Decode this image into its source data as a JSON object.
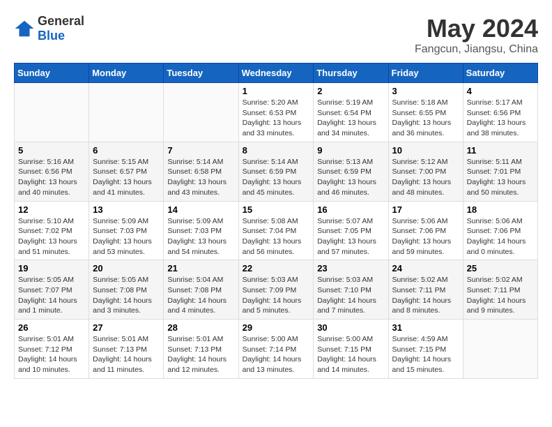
{
  "header": {
    "logo_general": "General",
    "logo_blue": "Blue",
    "month_title": "May 2024",
    "location": "Fangcun, Jiangsu, China"
  },
  "weekdays": [
    "Sunday",
    "Monday",
    "Tuesday",
    "Wednesday",
    "Thursday",
    "Friday",
    "Saturday"
  ],
  "weeks": [
    [
      {
        "day": "",
        "sunrise": "",
        "sunset": "",
        "daylight": ""
      },
      {
        "day": "",
        "sunrise": "",
        "sunset": "",
        "daylight": ""
      },
      {
        "day": "",
        "sunrise": "",
        "sunset": "",
        "daylight": ""
      },
      {
        "day": "1",
        "sunrise": "Sunrise: 5:20 AM",
        "sunset": "Sunset: 6:53 PM",
        "daylight": "Daylight: 13 hours and 33 minutes."
      },
      {
        "day": "2",
        "sunrise": "Sunrise: 5:19 AM",
        "sunset": "Sunset: 6:54 PM",
        "daylight": "Daylight: 13 hours and 34 minutes."
      },
      {
        "day": "3",
        "sunrise": "Sunrise: 5:18 AM",
        "sunset": "Sunset: 6:55 PM",
        "daylight": "Daylight: 13 hours and 36 minutes."
      },
      {
        "day": "4",
        "sunrise": "Sunrise: 5:17 AM",
        "sunset": "Sunset: 6:56 PM",
        "daylight": "Daylight: 13 hours and 38 minutes."
      }
    ],
    [
      {
        "day": "5",
        "sunrise": "Sunrise: 5:16 AM",
        "sunset": "Sunset: 6:56 PM",
        "daylight": "Daylight: 13 hours and 40 minutes."
      },
      {
        "day": "6",
        "sunrise": "Sunrise: 5:15 AM",
        "sunset": "Sunset: 6:57 PM",
        "daylight": "Daylight: 13 hours and 41 minutes."
      },
      {
        "day": "7",
        "sunrise": "Sunrise: 5:14 AM",
        "sunset": "Sunset: 6:58 PM",
        "daylight": "Daylight: 13 hours and 43 minutes."
      },
      {
        "day": "8",
        "sunrise": "Sunrise: 5:14 AM",
        "sunset": "Sunset: 6:59 PM",
        "daylight": "Daylight: 13 hours and 45 minutes."
      },
      {
        "day": "9",
        "sunrise": "Sunrise: 5:13 AM",
        "sunset": "Sunset: 6:59 PM",
        "daylight": "Daylight: 13 hours and 46 minutes."
      },
      {
        "day": "10",
        "sunrise": "Sunrise: 5:12 AM",
        "sunset": "Sunset: 7:00 PM",
        "daylight": "Daylight: 13 hours and 48 minutes."
      },
      {
        "day": "11",
        "sunrise": "Sunrise: 5:11 AM",
        "sunset": "Sunset: 7:01 PM",
        "daylight": "Daylight: 13 hours and 50 minutes."
      }
    ],
    [
      {
        "day": "12",
        "sunrise": "Sunrise: 5:10 AM",
        "sunset": "Sunset: 7:02 PM",
        "daylight": "Daylight: 13 hours and 51 minutes."
      },
      {
        "day": "13",
        "sunrise": "Sunrise: 5:09 AM",
        "sunset": "Sunset: 7:03 PM",
        "daylight": "Daylight: 13 hours and 53 minutes."
      },
      {
        "day": "14",
        "sunrise": "Sunrise: 5:09 AM",
        "sunset": "Sunset: 7:03 PM",
        "daylight": "Daylight: 13 hours and 54 minutes."
      },
      {
        "day": "15",
        "sunrise": "Sunrise: 5:08 AM",
        "sunset": "Sunset: 7:04 PM",
        "daylight": "Daylight: 13 hours and 56 minutes."
      },
      {
        "day": "16",
        "sunrise": "Sunrise: 5:07 AM",
        "sunset": "Sunset: 7:05 PM",
        "daylight": "Daylight: 13 hours and 57 minutes."
      },
      {
        "day": "17",
        "sunrise": "Sunrise: 5:06 AM",
        "sunset": "Sunset: 7:06 PM",
        "daylight": "Daylight: 13 hours and 59 minutes."
      },
      {
        "day": "18",
        "sunrise": "Sunrise: 5:06 AM",
        "sunset": "Sunset: 7:06 PM",
        "daylight": "Daylight: 14 hours and 0 minutes."
      }
    ],
    [
      {
        "day": "19",
        "sunrise": "Sunrise: 5:05 AM",
        "sunset": "Sunset: 7:07 PM",
        "daylight": "Daylight: 14 hours and 1 minute."
      },
      {
        "day": "20",
        "sunrise": "Sunrise: 5:05 AM",
        "sunset": "Sunset: 7:08 PM",
        "daylight": "Daylight: 14 hours and 3 minutes."
      },
      {
        "day": "21",
        "sunrise": "Sunrise: 5:04 AM",
        "sunset": "Sunset: 7:08 PM",
        "daylight": "Daylight: 14 hours and 4 minutes."
      },
      {
        "day": "22",
        "sunrise": "Sunrise: 5:03 AM",
        "sunset": "Sunset: 7:09 PM",
        "daylight": "Daylight: 14 hours and 5 minutes."
      },
      {
        "day": "23",
        "sunrise": "Sunrise: 5:03 AM",
        "sunset": "Sunset: 7:10 PM",
        "daylight": "Daylight: 14 hours and 7 minutes."
      },
      {
        "day": "24",
        "sunrise": "Sunrise: 5:02 AM",
        "sunset": "Sunset: 7:11 PM",
        "daylight": "Daylight: 14 hours and 8 minutes."
      },
      {
        "day": "25",
        "sunrise": "Sunrise: 5:02 AM",
        "sunset": "Sunset: 7:11 PM",
        "daylight": "Daylight: 14 hours and 9 minutes."
      }
    ],
    [
      {
        "day": "26",
        "sunrise": "Sunrise: 5:01 AM",
        "sunset": "Sunset: 7:12 PM",
        "daylight": "Daylight: 14 hours and 10 minutes."
      },
      {
        "day": "27",
        "sunrise": "Sunrise: 5:01 AM",
        "sunset": "Sunset: 7:13 PM",
        "daylight": "Daylight: 14 hours and 11 minutes."
      },
      {
        "day": "28",
        "sunrise": "Sunrise: 5:01 AM",
        "sunset": "Sunset: 7:13 PM",
        "daylight": "Daylight: 14 hours and 12 minutes."
      },
      {
        "day": "29",
        "sunrise": "Sunrise: 5:00 AM",
        "sunset": "Sunset: 7:14 PM",
        "daylight": "Daylight: 14 hours and 13 minutes."
      },
      {
        "day": "30",
        "sunrise": "Sunrise: 5:00 AM",
        "sunset": "Sunset: 7:15 PM",
        "daylight": "Daylight: 14 hours and 14 minutes."
      },
      {
        "day": "31",
        "sunrise": "Sunrise: 4:59 AM",
        "sunset": "Sunset: 7:15 PM",
        "daylight": "Daylight: 14 hours and 15 minutes."
      },
      {
        "day": "",
        "sunrise": "",
        "sunset": "",
        "daylight": ""
      }
    ]
  ]
}
